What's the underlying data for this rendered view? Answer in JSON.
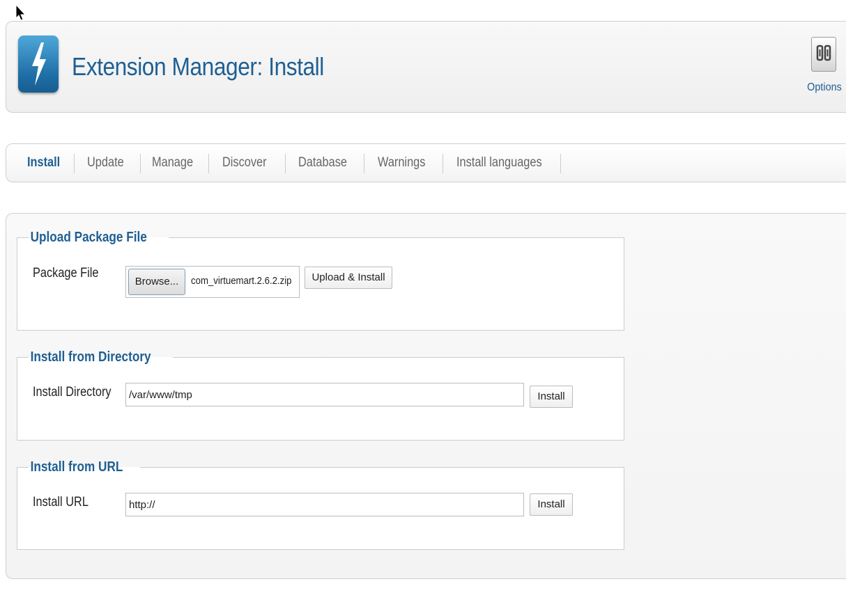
{
  "header": {
    "title": "Extension Manager: Install",
    "icon": "extension-lightning-icon",
    "options_label": "Options",
    "options_icon": "options-toggle-icon",
    "title_color": "#1f5f92"
  },
  "tabs": [
    {
      "label": "Install",
      "active": true
    },
    {
      "label": "Update"
    },
    {
      "label": "Manage"
    },
    {
      "label": "Discover"
    },
    {
      "label": "Database"
    },
    {
      "label": "Warnings"
    },
    {
      "label": "Install languages"
    }
  ],
  "upload": {
    "legend": "Upload Package File",
    "label": "Package File",
    "browse_label": "Browse...",
    "file_name": "com_virtuemart.2.6.2.zip",
    "button": "Upload & Install"
  },
  "directory": {
    "legend": "Install from Directory",
    "label": "Install Directory",
    "value": "/var/www/tmp",
    "button": "Install"
  },
  "url": {
    "legend": "Install from URL",
    "label": "Install URL",
    "value": "http://",
    "button": "Install"
  }
}
